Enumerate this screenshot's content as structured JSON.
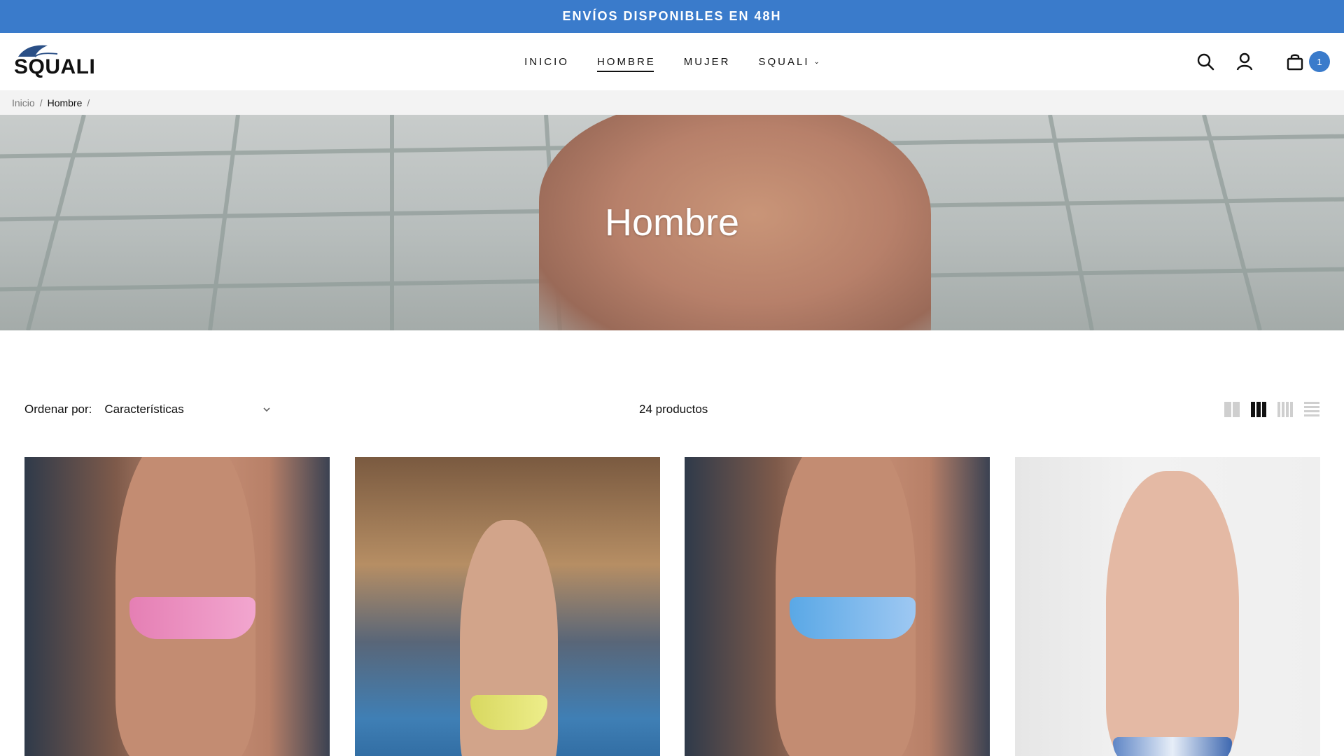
{
  "announcement": {
    "text": "ENVÍOS DISPONIBLES EN 48H"
  },
  "header": {
    "logo_text": "SQUALI",
    "nav": [
      {
        "label": "INICIO",
        "active": false
      },
      {
        "label": "HOMBRE",
        "active": true
      },
      {
        "label": "MUJER",
        "active": false
      },
      {
        "label": "SQUALI",
        "active": false,
        "has_dropdown": true
      }
    ],
    "icons": [
      "search-icon",
      "account-icon",
      "cart-icon"
    ],
    "cart_count": "1",
    "accent_color": "#3a7bcb"
  },
  "breadcrumb": {
    "items": [
      "Inicio",
      "Hombre"
    ],
    "separator": "/"
  },
  "hero": {
    "title": "Hombre"
  },
  "toolbar": {
    "sort_label": "Ordenar por:",
    "sort_value": "Características",
    "product_count": "24 productos",
    "views": [
      "grid-2",
      "grid-3",
      "grid-4",
      "list"
    ],
    "active_view": "grid-3"
  },
  "products": [
    {
      "image": "pink-swim-brief-photo"
    },
    {
      "image": "yellow-swim-brief-pool-photo"
    },
    {
      "image": "blue-swim-brief-photo"
    },
    {
      "image": "patterned-swim-brief-photo"
    }
  ]
}
